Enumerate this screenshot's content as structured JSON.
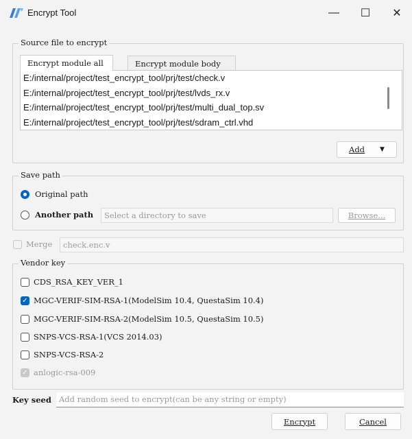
{
  "window": {
    "title": "Encrypt Tool",
    "min_label": "—",
    "max_label": "☐",
    "close_label": "✕"
  },
  "source": {
    "group_title": "Source file to encrypt",
    "tabs": [
      {
        "label": "Encrypt module all",
        "active": true
      },
      {
        "label": "Encrypt module body",
        "active": false
      }
    ],
    "files": [
      "E:/internal/project/test_encrypt_tool/prj/test/check.v",
      "E:/internal/project/test_encrypt_tool/prj/test/lvds_rx.v",
      "E:/internal/project/test_encrypt_tool/prj/test/multi_dual_top.sv",
      "E:/internal/project/test_encrypt_tool/prj/test/sdram_ctrl.vhd"
    ],
    "add_label": "Add",
    "add_arrow": "▼"
  },
  "save_path": {
    "group_title": "Save path",
    "original_label": "Original path",
    "another_label": "Another path",
    "dir_placeholder": "Select a directory to save",
    "browse_label": "Browse..."
  },
  "merge": {
    "label": "Merge",
    "value": "check.enc.v"
  },
  "vendor": {
    "group_title": "Vendor key",
    "keys": [
      {
        "label": "CDS_RSA_KEY_VER_1",
        "checked": false,
        "disabled": false
      },
      {
        "label": "MGC-VERIF-SIM-RSA-1(ModelSim 10.4, QuestaSim 10.4)",
        "checked": true,
        "disabled": false
      },
      {
        "label": "MGC-VERIF-SIM-RSA-2(ModelSim 10.5, QuestaSim 10.5)",
        "checked": false,
        "disabled": false
      },
      {
        "label": "SNPS-VCS-RSA-1(VCS 2014.03)",
        "checked": false,
        "disabled": false
      },
      {
        "label": "SNPS-VCS-RSA-2",
        "checked": false,
        "disabled": false
      },
      {
        "label": "anlogic-rsa-009",
        "checked": true,
        "disabled": true
      }
    ]
  },
  "key_seed": {
    "label": "Key seed",
    "placeholder": "Add random seed to encrypt(can be any string or empty)"
  },
  "actions": {
    "encrypt_label": "Encrypt",
    "cancel_label": "Cancel"
  },
  "colors": {
    "accent": "#0067c0",
    "background": "#f3f3f3"
  }
}
